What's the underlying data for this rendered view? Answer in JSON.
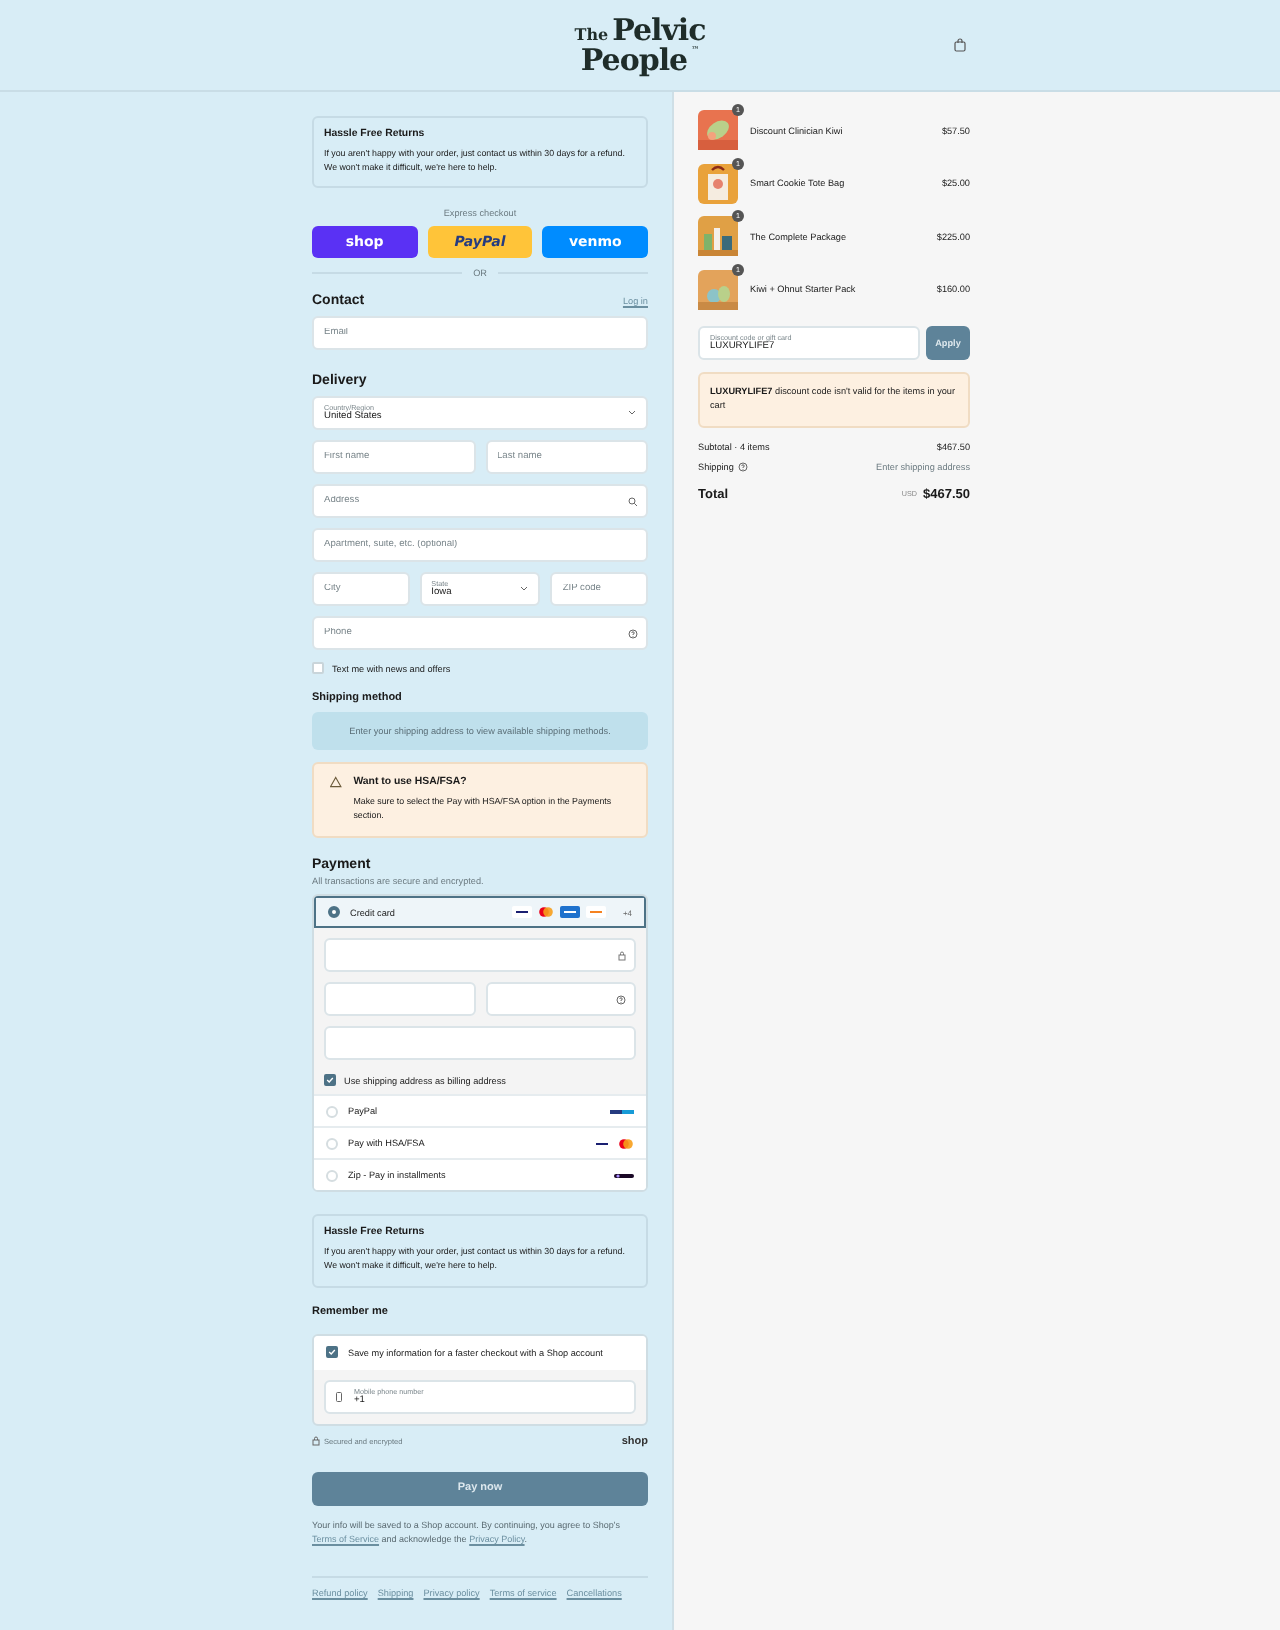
{
  "logo": {
    "small": "The",
    "line1": "Pelvic",
    "line2": "People",
    "mark": "™"
  },
  "returns_notices": [
    {
      "title": "Hassle Free Returns",
      "body": "If you aren't happy with your order, just contact us within 30 days for a refund. We won't make it difficult, we're here to help."
    },
    {
      "title": "Hassle Free Returns",
      "body": "If you aren't happy with your order, just contact us within 30 days for a refund. We won't make it difficult, we're here to help."
    }
  ],
  "express": {
    "label": "Express checkout",
    "divider": "OR",
    "buttons": [
      {
        "label": "shop",
        "kind": "shop"
      },
      {
        "label": "PayPal",
        "kind": "paypal"
      },
      {
        "label": "venmo",
        "kind": "venmo"
      }
    ]
  },
  "contact": {
    "title": "Contact",
    "link": "Log in",
    "email": {
      "placeholder": "Email"
    }
  },
  "delivery": {
    "title": "Delivery",
    "country": {
      "label": "Country/Region",
      "value": "United States"
    },
    "first_name": {
      "placeholder": "First name"
    },
    "last_name": {
      "placeholder": "Last name"
    },
    "address": {
      "placeholder": "Address"
    },
    "apartment": {
      "placeholder": "Apartment, suite, etc. (optional)"
    },
    "city": {
      "placeholder": "City"
    },
    "state": {
      "label": "State",
      "value": "Iowa"
    },
    "zip": {
      "placeholder": "ZIP code"
    },
    "phone": {
      "placeholder": "Phone"
    },
    "sms": {
      "label": "Text me with news and offers",
      "checked": false
    }
  },
  "shipping": {
    "title": "Shipping method",
    "message": "Enter your shipping address to view available shipping methods."
  },
  "hsa_notice": {
    "title": "Want to use HSA/FSA?",
    "body": "Make sure to select the Pay with HSA/FSA option in the Payments section."
  },
  "payment": {
    "title": "Payment",
    "subtitle": "All transactions are secure and encrypted.",
    "billing": {
      "label": "Use shipping address as billing address",
      "checked": true
    },
    "methods": [
      {
        "label": "Credit card",
        "kind": "card",
        "selected": true,
        "more": "+4"
      },
      {
        "label": "PayPal",
        "kind": "paypal",
        "selected": false
      },
      {
        "label": "Pay with HSA/FSA",
        "kind": "hsa",
        "selected": false
      },
      {
        "label": "Zip - Pay in installments",
        "kind": "zip",
        "selected": false
      }
    ]
  },
  "remember": {
    "title": "Remember me",
    "save": {
      "label": "Save my information for a faster checkout with a Shop account",
      "checked": true
    },
    "phone": {
      "label": "Mobile phone number",
      "value": "+1"
    },
    "secure": "Secured and encrypted",
    "brand": "shop"
  },
  "pay_button": "Pay now",
  "legal": {
    "before": "Your info will be saved to a Shop account. By continuing, you agree to Shop's",
    "terms": "Terms of Service",
    "middle": "and acknowledge the",
    "privacy": "Privacy Policy",
    "after": "."
  },
  "footer_links": [
    "Refund policy",
    "Shipping",
    "Privacy policy",
    "Terms of service",
    "Cancellations"
  ],
  "cart": {
    "items": [
      {
        "name": "Discount Clinician Kiwi",
        "price": "$57.50",
        "quantity": "1"
      },
      {
        "name": "Smart Cookie Tote Bag",
        "price": "$25.00",
        "quantity": "1"
      },
      {
        "name": "The Complete Package",
        "price": "$225.00",
        "quantity": "1"
      },
      {
        "name": "Kiwi + Ohnut Starter Pack",
        "price": "$160.00",
        "quantity": "1"
      }
    ],
    "discount": {
      "label": "Discount code or gift card",
      "value": "LUXURYLIFE7"
    },
    "apply": "Apply",
    "error": "**LUXURYLIFE7** discount code isn't valid for the items in your cart",
    "subtotal_label": "Subtotal · 4 items",
    "subtotal": "$467.50",
    "shipping_label": "Shipping",
    "shipping_value": "Enter shipping address",
    "total_label": "Total",
    "currency": "USD",
    "total": "$467.50"
  }
}
